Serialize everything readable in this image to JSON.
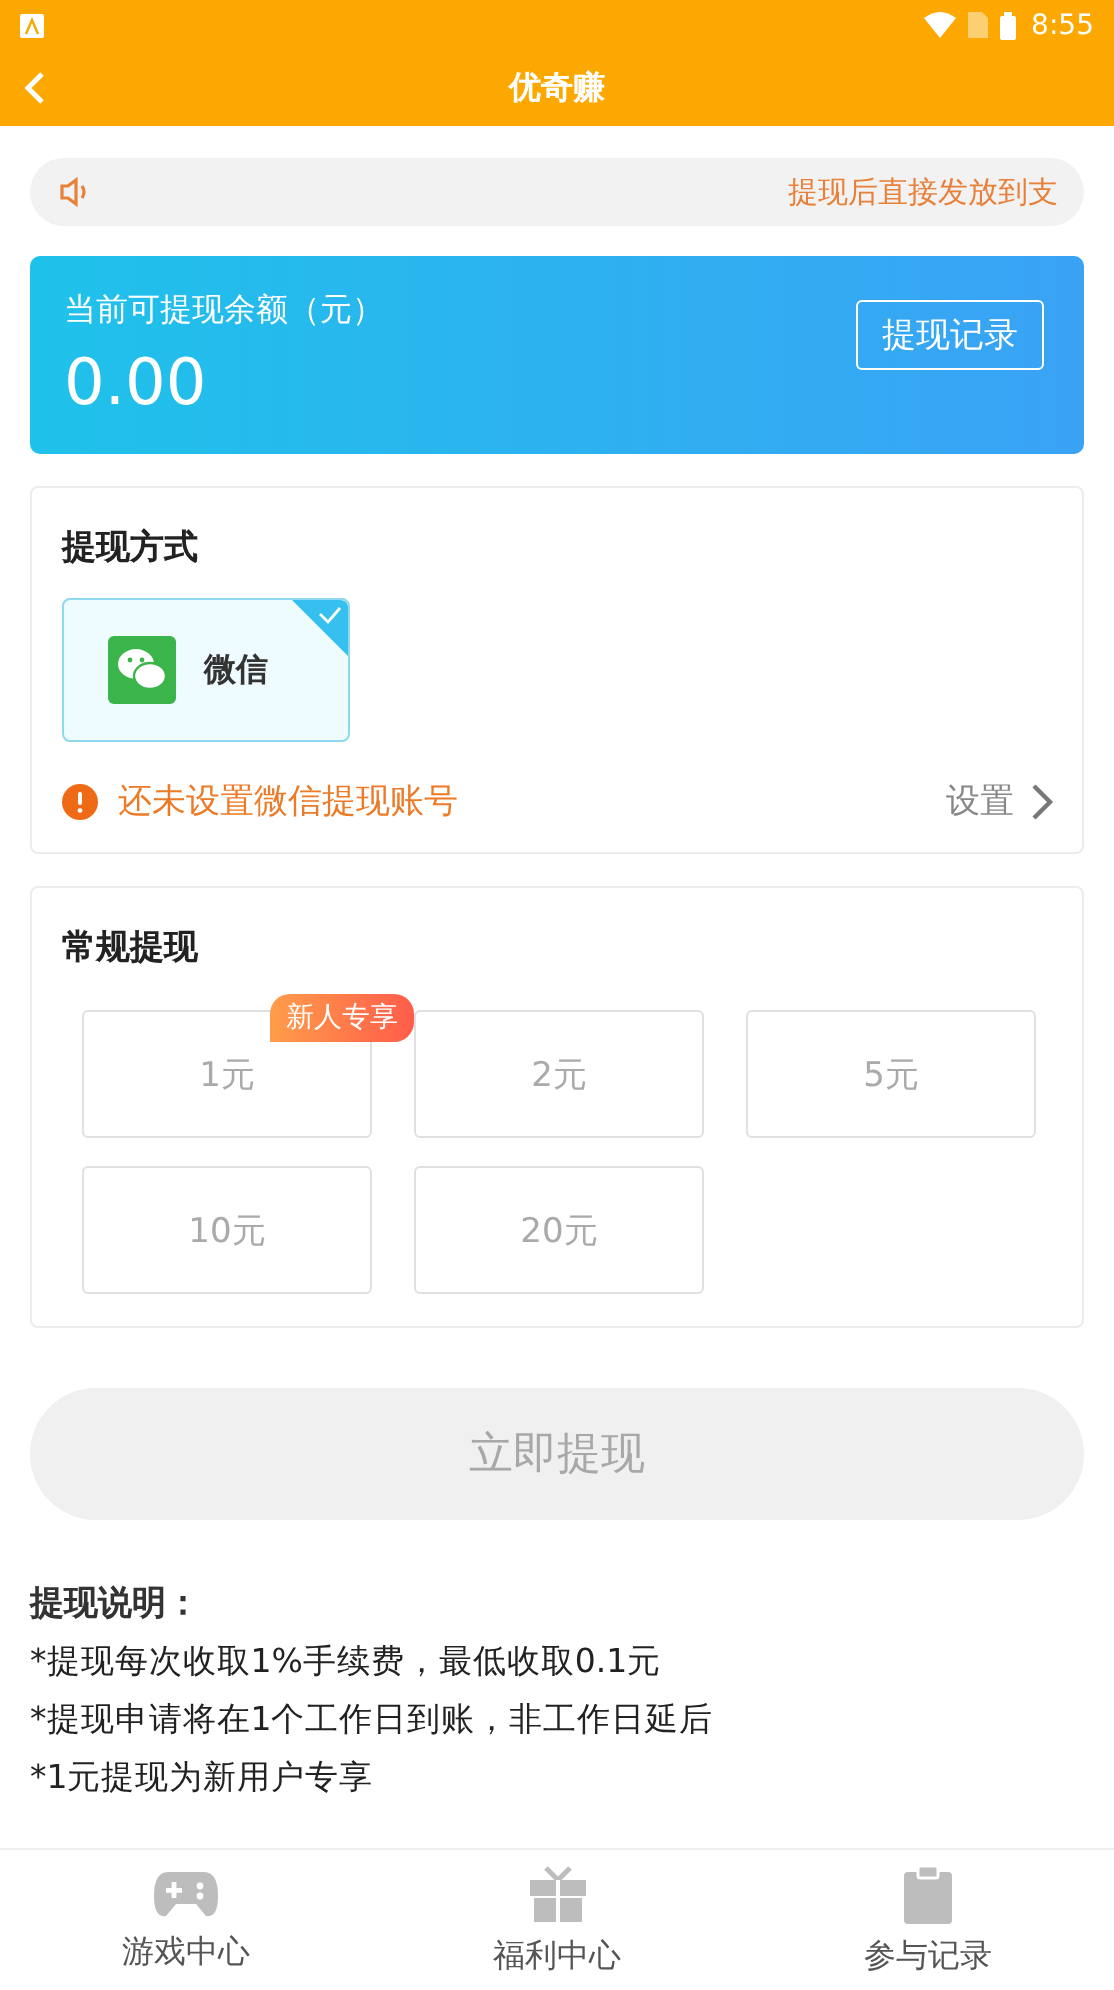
{
  "status_bar": {
    "time": "8:55"
  },
  "header": {
    "title": "优奇赚"
  },
  "notice": {
    "text": "提现后直接发放到支"
  },
  "balance": {
    "label": "当前可提现余额（元）",
    "amount": "0.00",
    "button": "提现记录"
  },
  "method": {
    "title": "提现方式",
    "options": [
      {
        "label": "微信",
        "selected": true
      }
    ],
    "warning": "还未设置微信提现账号",
    "setting": "设置"
  },
  "regular": {
    "title": "常规提现",
    "amounts": [
      {
        "label": "1元",
        "badge": "新人专享"
      },
      {
        "label": "2元"
      },
      {
        "label": "5元"
      },
      {
        "label": "10元"
      },
      {
        "label": "20元"
      }
    ]
  },
  "submit": {
    "label": "立即提现",
    "disabled": true
  },
  "notes": {
    "title": "提现说明：",
    "items": [
      "*提现每次收取1%手续费，最低收取0.1元",
      "*提现申请将在1个工作日到账，非工作日延后",
      "*1元提现为新用户专享"
    ]
  },
  "tabs": [
    {
      "label": "游戏中心"
    },
    {
      "label": "福利中心"
    },
    {
      "label": "参与记录"
    }
  ]
}
